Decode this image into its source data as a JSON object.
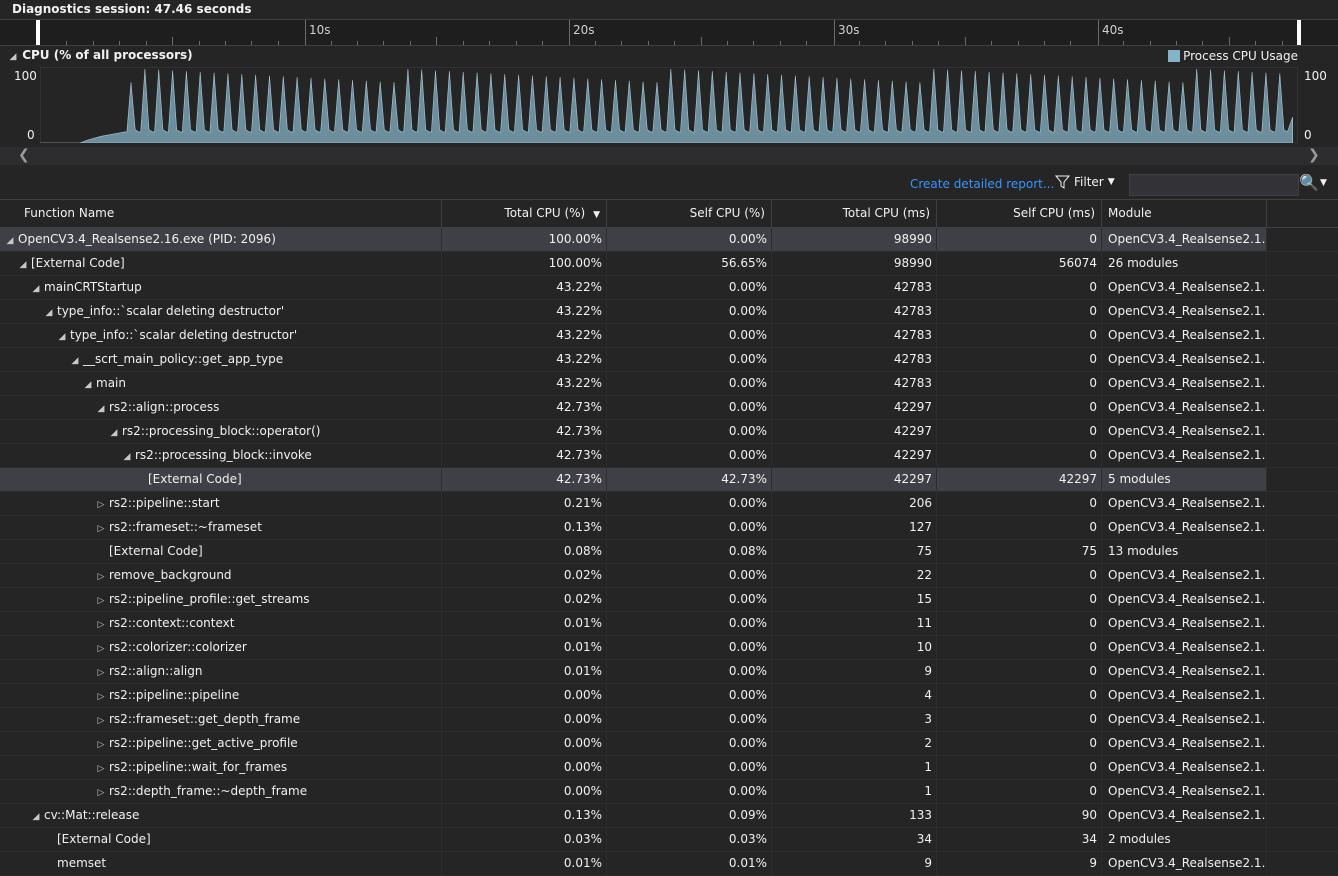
{
  "session": {
    "title": "Diagnostics session: 47.46 seconds"
  },
  "ruler": {
    "ticks": [
      "10s",
      "20s",
      "30s",
      "40s"
    ]
  },
  "cpu_chart": {
    "title": "CPU (% of all processors)",
    "legend": "Process CPU Usage",
    "y_max_label": "100",
    "y_min_label": "0",
    "color": "#86b2c6"
  },
  "chart_data": {
    "type": "area",
    "title": "CPU (% of all processors)",
    "series": [
      {
        "name": "Process CPU Usage"
      }
    ],
    "ylim": [
      0,
      100
    ],
    "xlim": [
      0,
      47.46
    ],
    "pattern": {
      "start_s": 1.5,
      "ramp_end_s": 3.2,
      "peak_count": 84,
      "peak_min": 82,
      "peak_max": 100,
      "base": 15
    }
  },
  "toolbar": {
    "report_link": "Create detailed report...",
    "filter_label": "Filter"
  },
  "grid": {
    "headers": [
      "Function Name",
      "Total CPU (%)",
      "Self CPU (%)",
      "Total CPU (ms)",
      "Self CPU (ms)",
      "Module"
    ],
    "rows": [
      {
        "name": "OpenCV3.4_Realsense2.16.exe (PID: 2096)",
        "total_pct": "100.00%",
        "self_pct": "0.00%",
        "total_ms": "98990",
        "self_ms": "0",
        "module": "OpenCV3.4_Realsense2.1…"
      },
      {
        "name": "[External Code]",
        "total_pct": "100.00%",
        "self_pct": "56.65%",
        "total_ms": "98990",
        "self_ms": "56074",
        "module": "26 modules"
      },
      {
        "name": "mainCRTStartup",
        "total_pct": "43.22%",
        "self_pct": "0.00%",
        "total_ms": "42783",
        "self_ms": "0",
        "module": "OpenCV3.4_Realsense2.1…"
      },
      {
        "name": "type_info::`scalar deleting destructor'",
        "total_pct": "43.22%",
        "self_pct": "0.00%",
        "total_ms": "42783",
        "self_ms": "0",
        "module": "OpenCV3.4_Realsense2.1…"
      },
      {
        "name": "type_info::`scalar deleting destructor'",
        "total_pct": "43.22%",
        "self_pct": "0.00%",
        "total_ms": "42783",
        "self_ms": "0",
        "module": "OpenCV3.4_Realsense2.1…"
      },
      {
        "name": "__scrt_main_policy::get_app_type",
        "total_pct": "43.22%",
        "self_pct": "0.00%",
        "total_ms": "42783",
        "self_ms": "0",
        "module": "OpenCV3.4_Realsense2.1…"
      },
      {
        "name": "main",
        "total_pct": "43.22%",
        "self_pct": "0.00%",
        "total_ms": "42783",
        "self_ms": "0",
        "module": "OpenCV3.4_Realsense2.1…"
      },
      {
        "name": "rs2::align::process",
        "total_pct": "42.73%",
        "self_pct": "0.00%",
        "total_ms": "42297",
        "self_ms": "0",
        "module": "OpenCV3.4_Realsense2.1…"
      },
      {
        "name": "rs2::processing_block::operator()",
        "total_pct": "42.73%",
        "self_pct": "0.00%",
        "total_ms": "42297",
        "self_ms": "0",
        "module": "OpenCV3.4_Realsense2.1…"
      },
      {
        "name": "rs2::processing_block::invoke",
        "total_pct": "42.73%",
        "self_pct": "0.00%",
        "total_ms": "42297",
        "self_ms": "0",
        "module": "OpenCV3.4_Realsense2.1…"
      },
      {
        "name": "[External Code]",
        "total_pct": "42.73%",
        "self_pct": "42.73%",
        "total_ms": "42297",
        "self_ms": "42297",
        "module": "5 modules"
      },
      {
        "name": "rs2::pipeline::start",
        "total_pct": "0.21%",
        "self_pct": "0.00%",
        "total_ms": "206",
        "self_ms": "0",
        "module": "OpenCV3.4_Realsense2.1…"
      },
      {
        "name": "rs2::frameset::~frameset",
        "total_pct": "0.13%",
        "self_pct": "0.00%",
        "total_ms": "127",
        "self_ms": "0",
        "module": "OpenCV3.4_Realsense2.1…"
      },
      {
        "name": "[External Code]",
        "total_pct": "0.08%",
        "self_pct": "0.08%",
        "total_ms": "75",
        "self_ms": "75",
        "module": "13 modules"
      },
      {
        "name": "remove_background",
        "total_pct": "0.02%",
        "self_pct": "0.00%",
        "total_ms": "22",
        "self_ms": "0",
        "module": "OpenCV3.4_Realsense2.1…"
      },
      {
        "name": "rs2::pipeline_profile::get_streams",
        "total_pct": "0.02%",
        "self_pct": "0.00%",
        "total_ms": "15",
        "self_ms": "0",
        "module": "OpenCV3.4_Realsense2.1…"
      },
      {
        "name": "rs2::context::context",
        "total_pct": "0.01%",
        "self_pct": "0.00%",
        "total_ms": "11",
        "self_ms": "0",
        "module": "OpenCV3.4_Realsense2.1…"
      },
      {
        "name": "rs2::colorizer::colorizer",
        "total_pct": "0.01%",
        "self_pct": "0.00%",
        "total_ms": "10",
        "self_ms": "0",
        "module": "OpenCV3.4_Realsense2.1…"
      },
      {
        "name": "rs2::align::align",
        "total_pct": "0.01%",
        "self_pct": "0.00%",
        "total_ms": "9",
        "self_ms": "0",
        "module": "OpenCV3.4_Realsense2.1…"
      },
      {
        "name": "rs2::pipeline::pipeline",
        "total_pct": "0.00%",
        "self_pct": "0.00%",
        "total_ms": "4",
        "self_ms": "0",
        "module": "OpenCV3.4_Realsense2.1…"
      },
      {
        "name": "rs2::frameset::get_depth_frame",
        "total_pct": "0.00%",
        "self_pct": "0.00%",
        "total_ms": "3",
        "self_ms": "0",
        "module": "OpenCV3.4_Realsense2.1…"
      },
      {
        "name": "rs2::pipeline::get_active_profile",
        "total_pct": "0.00%",
        "self_pct": "0.00%",
        "total_ms": "2",
        "self_ms": "0",
        "module": "OpenCV3.4_Realsense2.1…"
      },
      {
        "name": "rs2::pipeline::wait_for_frames",
        "total_pct": "0.00%",
        "self_pct": "0.00%",
        "total_ms": "1",
        "self_ms": "0",
        "module": "OpenCV3.4_Realsense2.1…"
      },
      {
        "name": "rs2::depth_frame::~depth_frame",
        "total_pct": "0.00%",
        "self_pct": "0.00%",
        "total_ms": "1",
        "self_ms": "0",
        "module": "OpenCV3.4_Realsense2.1…"
      },
      {
        "name": "cv::Mat::release",
        "total_pct": "0.13%",
        "self_pct": "0.09%",
        "total_ms": "133",
        "self_ms": "90",
        "module": "OpenCV3.4_Realsense2.1…"
      },
      {
        "name": "[External Code]",
        "total_pct": "0.03%",
        "self_pct": "0.03%",
        "total_ms": "34",
        "self_ms": "34",
        "module": "2 modules"
      },
      {
        "name": "memset",
        "total_pct": "0.01%",
        "self_pct": "0.01%",
        "total_ms": "9",
        "self_ms": "9",
        "module": "OpenCV3.4_Realsense2.1…"
      }
    ]
  }
}
